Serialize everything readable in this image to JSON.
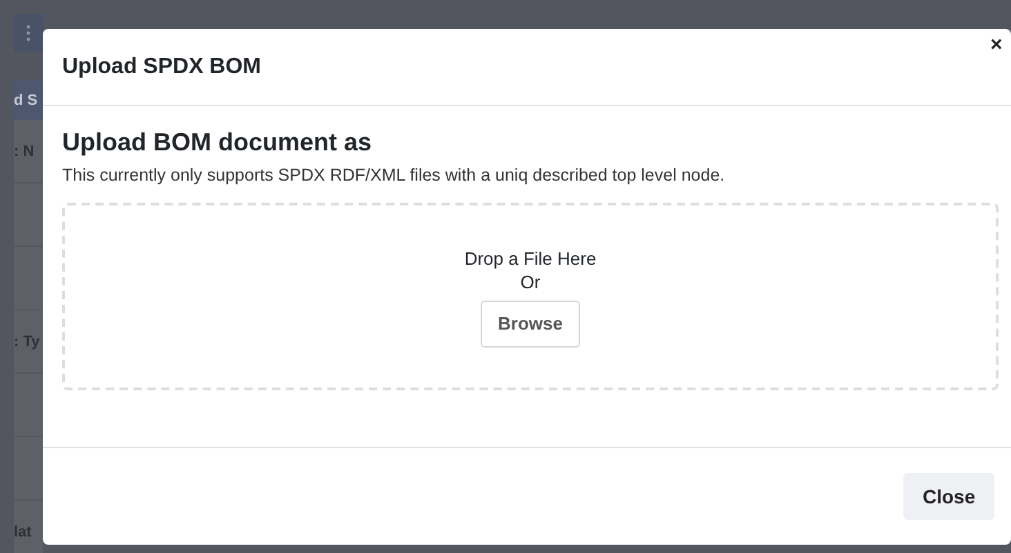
{
  "background_page": {
    "header_bar": "d S",
    "rows": [
      ": N",
      ": Ty",
      "lat"
    ]
  },
  "modal": {
    "title": "Upload SPDX BOM",
    "close_icon": "×",
    "heading": "Upload BOM document as",
    "description": "This currently only supports SPDX RDF/XML files with a uniq described top level node.",
    "dropzone": {
      "prompt": "Drop a File Here",
      "separator": "Or",
      "browse_button": "Browse"
    },
    "buttons": [
      "Close"
    ]
  }
}
